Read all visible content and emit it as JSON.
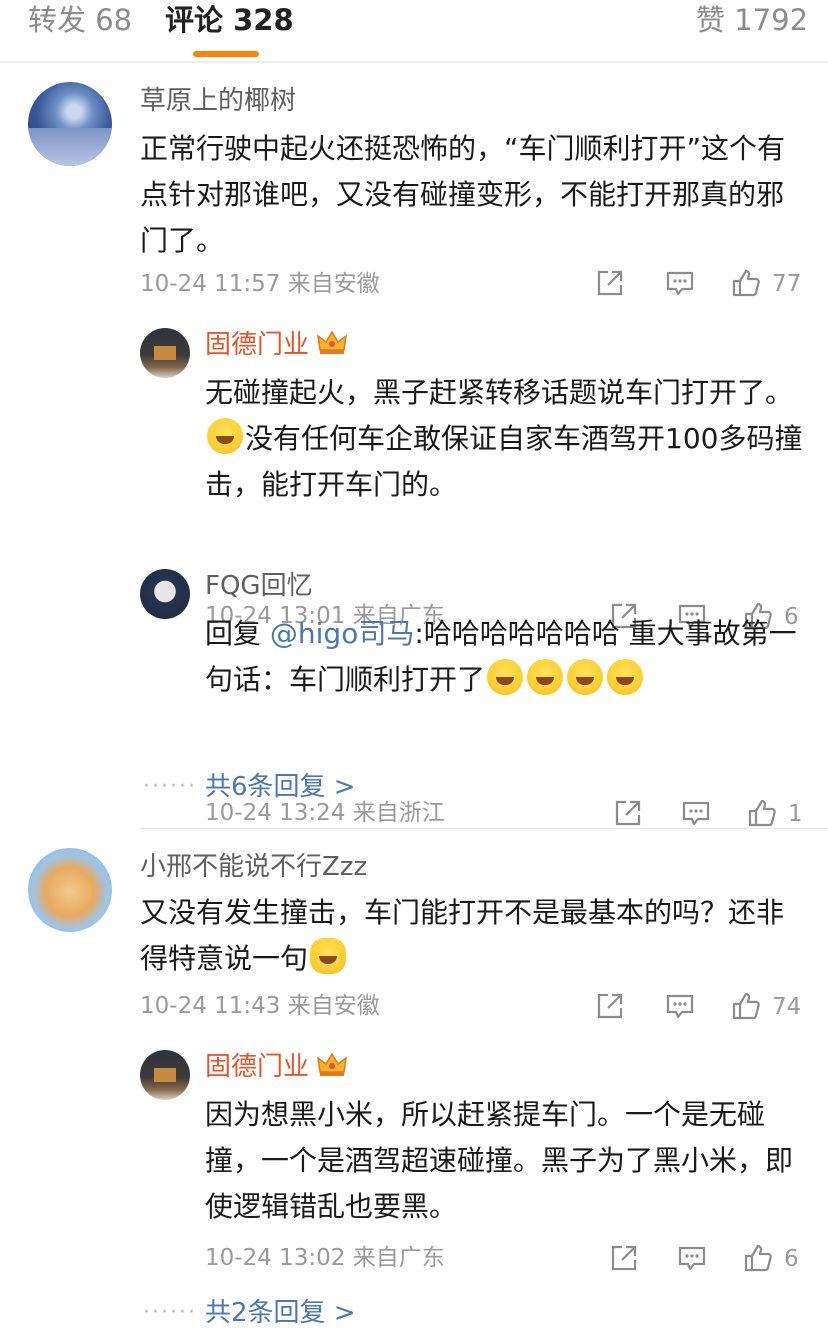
{
  "tabs": {
    "repost": "转发 68",
    "comments": "评论 328",
    "likes": "赞 1792"
  },
  "comments": [
    {
      "user": "草原上的椰树",
      "text": "正常行驶中起火还挺恐怖的，“车门顺利打开”这个有点针对那谁吧，又没有碰撞变形，不能打开那真的邪门了。",
      "meta": "10-24 11:57 来自安徽",
      "likes": "77",
      "replies": [
        {
          "user": "固德门业",
          "text_before": "无碰撞起火，黑子赶紧转移话题说车门打开了。",
          "text_after": "没有任何车企敢保证自家车酒驾开100多码撞击，能打开车门的。",
          "meta": "10-24 13:01 来自广东",
          "likes": "6"
        },
        {
          "user": "FQG回忆",
          "reply_prefix": "回复 ",
          "mention": "@higo司马",
          "text": ":哈哈哈哈哈哈哈 重大事故第一句话：车门顺利打开了",
          "meta": "10-24 13:24 来自浙江",
          "likes": "1"
        }
      ],
      "more_replies": "共6条回复 >"
    },
    {
      "user": "小邢不能说不行Zzz",
      "text": "又没有发生撞击，车门能打开不是最基本的吗？还非得特意说一句",
      "meta": "10-24 11:43 来自安徽",
      "likes": "74",
      "replies": [
        {
          "user": "固德门业",
          "text": "因为想黑小米，所以赶紧提车门。一个是无碰撞，一个是酒驾超速碰撞。黑子为了黑小米，即使逻辑错乱也要黑。",
          "meta": "10-24 13:02 来自广东",
          "likes": "6"
        }
      ],
      "more_replies": "共2条回复 >"
    }
  ],
  "icons": {
    "share": "share-icon",
    "comment": "comment-icon",
    "like": "thumbs-up-icon",
    "crown": "crown-badge-icon",
    "emoji_laugh": "laugh-cry-emoji",
    "emoji_smirk": "smirk-emoji"
  },
  "colors": {
    "accent": "#ff8200",
    "username_vip": "#e8542a",
    "link": "#4a77b5"
  }
}
